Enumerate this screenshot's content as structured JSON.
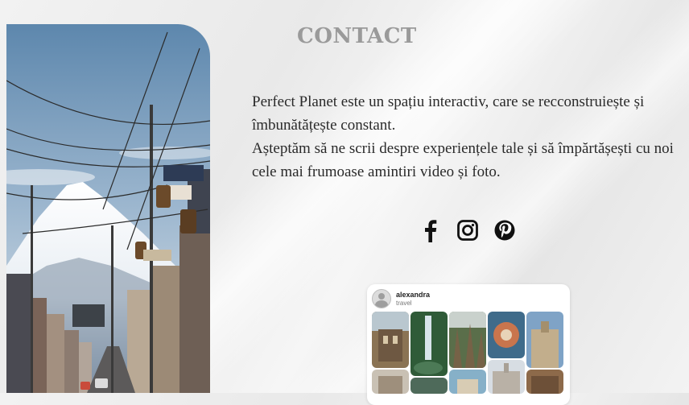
{
  "contact": {
    "title": "CONTACT",
    "line1": "Perfect Planet este un spațiu interactiv, care se recconstruiește și îmbunătățește constant.",
    "line2": "Așteptăm să ne scrii despre experiențele tale și să împărtășești cu noi cele mai frumoase amintiri video și foto."
  },
  "social": {
    "icons": [
      "facebook-icon",
      "instagram-icon",
      "pinterest-icon"
    ],
    "color": "#111111"
  },
  "pinterest_card": {
    "username": "alexandra",
    "category": "travel"
  },
  "colors": {
    "title": "#9a9a9a",
    "text": "#2a2a2a",
    "background": "#eeeeee"
  }
}
